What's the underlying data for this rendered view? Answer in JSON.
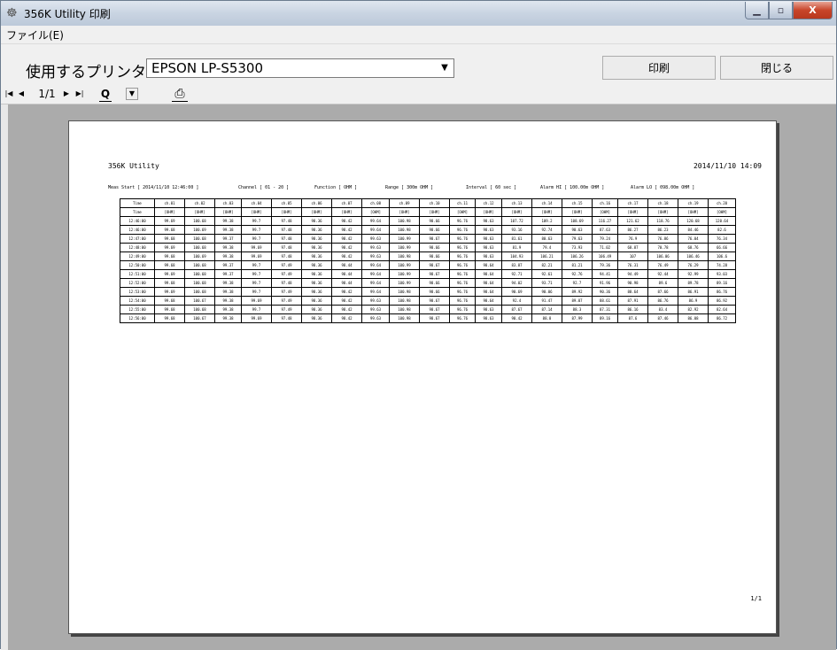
{
  "window": {
    "title": "356K Utility  印刷"
  },
  "menu": {
    "file": "ファイル(E)"
  },
  "printer": {
    "label": "使用するプリンタ",
    "value": "EPSON LP-S5300"
  },
  "buttons": {
    "print": "印刷",
    "close": "閉じる"
  },
  "toolbar": {
    "first": "|◀",
    "prev": "◀",
    "page": "1/1",
    "next": "▶",
    "last": "▶|",
    "zoom": "Q",
    "zoom_drop": "▼",
    "print": "⎙"
  },
  "report": {
    "title": "356K Utility",
    "datetime": "2014/11/10  14:09",
    "meas_start": "Meas Start [ 2014/11/10 12:46:00 ]",
    "channel": "Channel [ 01 - 20 ]",
    "function": "Function [ OHM ]",
    "range": "Range [ 300m OHM ]",
    "interval": "Interval [  60 sec ]",
    "alarm_hi": "Alarm HI [ 100.00m OHM ]",
    "alarm_lo": "Alarm LO [ 098.00m OHM ]",
    "page": "1/1",
    "header1": [
      "Time",
      "ch.01",
      "ch.02",
      "ch.03",
      "ch.04",
      "ch.05",
      "ch.06",
      "ch.07",
      "ch.08",
      "ch.09",
      "ch.10",
      "ch.11",
      "ch.12",
      "ch.13",
      "ch.14",
      "ch.15",
      "ch.16",
      "ch.17",
      "ch.18",
      "ch.19",
      "ch.20"
    ],
    "header2": [
      "Time",
      "[OHM]",
      "[OHM]",
      "[OHM]",
      "[OHM]",
      "[OHM]",
      "[OHM]",
      "[OHM]",
      "[OHM]",
      "[OHM]",
      "[OHM]",
      "[OHM]",
      "[OHM]",
      "[OHM]",
      "[OHM]",
      "[OHM]",
      "[OHM]",
      "[OHM]",
      "[OHM]",
      "[OHM]",
      "[OHM]"
    ],
    "rows": [
      [
        "12:46:00",
        "99.69",
        "100.68",
        "99.38",
        "99.7",
        "97.48",
        "98.36",
        "98.42",
        "99.64",
        "100.98",
        "98.66",
        "96.76",
        "98.63",
        "107.72",
        "109.2",
        "108.69",
        "116.27",
        "121.62",
        "118.76",
        "120.68",
        "120.64"
      ],
      [
        "12:46:00",
        "99.68",
        "100.69",
        "99.38",
        "99.7",
        "97.48",
        "98.36",
        "98.42",
        "99.64",
        "100.98",
        "98.66",
        "96.76",
        "98.63",
        "93.16",
        "92.74",
        "90.63",
        "87.63",
        "86.27",
        "86.23",
        "84.46",
        "82.6"
      ],
      [
        "12:47:00",
        "99.68",
        "100.68",
        "99.37",
        "99.7",
        "97.48",
        "98.36",
        "98.42",
        "99.63",
        "100.99",
        "98.67",
        "96.76",
        "98.63",
        "81.61",
        "80.63",
        "79.63",
        "79.24",
        "76.9",
        "76.86",
        "76.04",
        "76.34"
      ],
      [
        "12:48:00",
        "99.69",
        "100.68",
        "99.38",
        "99.69",
        "97.48",
        "98.36",
        "98.42",
        "99.63",
        "100.99",
        "98.66",
        "96.76",
        "98.63",
        "81.9",
        "79.4",
        "73.93",
        "71.02",
        "68.87",
        "70.78",
        "68.76",
        "66.66"
      ],
      [
        "12:49:00",
        "99.68",
        "100.69",
        "99.38",
        "99.69",
        "97.48",
        "98.36",
        "98.42",
        "99.63",
        "100.98",
        "98.66",
        "96.76",
        "98.63",
        "104.93",
        "106.21",
        "106.26",
        "106.49",
        "107",
        "106.06",
        "106.46",
        "106.6"
      ],
      [
        "12:50:00",
        "99.68",
        "100.68",
        "99.37",
        "99.7",
        "97.49",
        "98.36",
        "98.44",
        "99.64",
        "100.99",
        "98.67",
        "96.76",
        "98.64",
        "83.87",
        "82.21",
        "81.21",
        "79.36",
        "76.31",
        "76.49",
        "76.29",
        "74.28"
      ],
      [
        "12:51:00",
        "99.69",
        "100.68",
        "99.37",
        "99.7",
        "97.49",
        "98.36",
        "98.44",
        "99.64",
        "100.99",
        "98.67",
        "96.76",
        "98.64",
        "92.71",
        "92.61",
        "92.76",
        "94.41",
        "94.49",
        "92.44",
        "92.99",
        "93.03"
      ],
      [
        "12:52:00",
        "99.68",
        "100.68",
        "99.38",
        "99.7",
        "97.48",
        "98.36",
        "98.44",
        "99.64",
        "100.99",
        "98.66",
        "96.76",
        "98.64",
        "94.02",
        "93.71",
        "92.7",
        "91.96",
        "90.98",
        "89.6",
        "89.78",
        "89.16"
      ],
      [
        "12:53:00",
        "99.69",
        "100.68",
        "99.38",
        "99.7",
        "97.49",
        "98.36",
        "98.42",
        "99.64",
        "100.98",
        "98.66",
        "96.76",
        "98.64",
        "90.69",
        "90.06",
        "89.92",
        "90.36",
        "88.64",
        "87.66",
        "86.91",
        "86.76"
      ],
      [
        "12:54:00",
        "99.68",
        "100.67",
        "99.38",
        "99.69",
        "97.49",
        "98.36",
        "98.42",
        "99.63",
        "100.98",
        "98.67",
        "96.76",
        "98.64",
        "92.4",
        "91.47",
        "89.07",
        "88.61",
        "87.91",
        "86.76",
        "86.9",
        "86.92"
      ],
      [
        "12:55:00",
        "99.68",
        "100.68",
        "99.38",
        "99.7",
        "97.49",
        "98.36",
        "98.42",
        "99.63",
        "100.98",
        "98.67",
        "96.76",
        "98.63",
        "87.67",
        "87.14",
        "88.3",
        "87.31",
        "86.16",
        "83.4",
        "82.92",
        "82.64"
      ],
      [
        "12:56:00",
        "99.68",
        "100.67",
        "99.38",
        "99.69",
        "97.48",
        "98.36",
        "98.42",
        "99.63",
        "100.98",
        "98.67",
        "96.76",
        "98.63",
        "90.42",
        "88.8",
        "87.99",
        "89.16",
        "87.6",
        "87.46",
        "86.08",
        "86.72"
      ]
    ]
  }
}
